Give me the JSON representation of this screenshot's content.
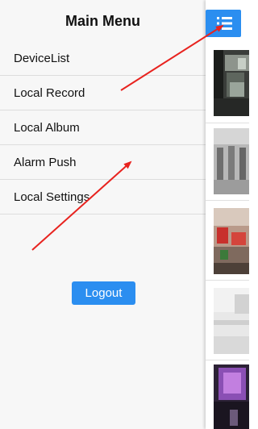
{
  "menu": {
    "title": "Main Menu",
    "items": [
      {
        "label": "DeviceList"
      },
      {
        "label": "Local Record"
      },
      {
        "label": "Local Album"
      },
      {
        "label": "Alarm Push"
      },
      {
        "label": "Local Settings"
      }
    ],
    "logout_label": "Logout"
  },
  "toolbar": {
    "menu_icon": "hamburger-list-icon"
  },
  "colors": {
    "accent": "#2b8ef0",
    "annotation_arrow": "#e8231f"
  }
}
